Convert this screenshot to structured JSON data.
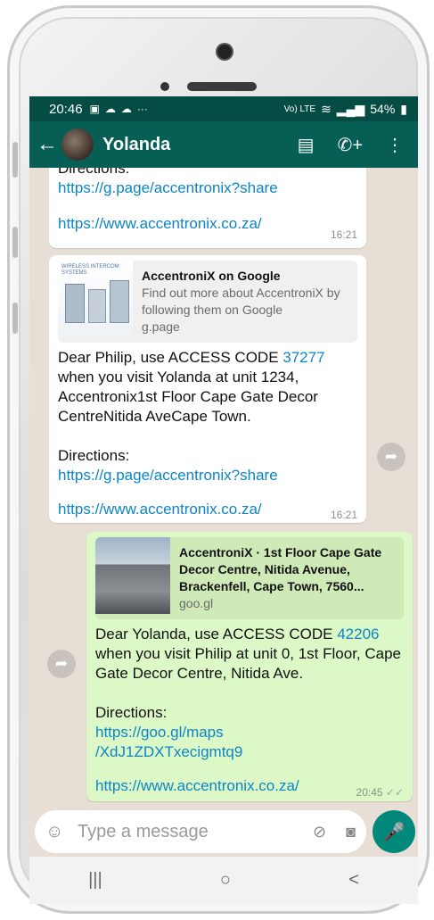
{
  "status_bar": {
    "time": "20:46",
    "left_icons": [
      "image-icon",
      "cloud-icon",
      "cloud-icon",
      "more-icon"
    ],
    "signal_label": "Vo) LTE",
    "battery": "54%"
  },
  "header": {
    "back_icon": "arrow-left-icon",
    "contact_name": "Yolanda",
    "actions": [
      "store-icon",
      "add-call-icon",
      "more-vert-icon"
    ]
  },
  "messages": [
    {
      "direction": "in",
      "partial_top": "Directions:",
      "links": [
        "https://g.page/accentronix?share",
        "https://www.accentronix.co.za/"
      ],
      "time": "16:21"
    },
    {
      "direction": "in",
      "preview": {
        "thumb_caption": "WIRELESS INTERCOM SYSTEMS",
        "title": "AccentroniX on Google",
        "desc": "Find out more about AccentroniX by following them on Google",
        "domain": "g.page"
      },
      "text_before": "Dear Philip, use ACCESS CODE ",
      "code": "37277",
      "text_after": "when you visit Yolanda at unit 1234, Accentronix1st Floor Cape Gate Decor CentreNitida AveCape Town.",
      "directions_label": "Directions:",
      "links": [
        "https://g.page/accentronix?share",
        "https://www.accentronix.co.za/"
      ],
      "time": "16:21"
    },
    {
      "direction": "out",
      "preview": {
        "title": "AccentroniX · 1st Floor Cape Gate Decor Centre, Nitida Avenue, Brackenfell, Cape Town, 7560...",
        "domain": "goo.gl"
      },
      "text_before": "Dear Yolanda, use ACCESS CODE ",
      "code": "42206",
      "text_after": "when you visit Philip at unit 0, 1st Floor, Cape Gate Decor Centre, Nitida Ave.",
      "directions_label": "Directions:",
      "links": [
        "https://goo.gl/maps /XdJ1ZDXTxecigmtq9",
        "https://www.accentronix.co.za/"
      ],
      "time": "20:45",
      "ticks": "✓✓"
    }
  ],
  "input": {
    "placeholder": "Type a message"
  },
  "nav": {
    "recents": "|||",
    "home": "○",
    "back": "<"
  },
  "colors": {
    "header": "#075e54",
    "status": "#054d44",
    "chat_bg": "#e7ded6",
    "outgoing": "#dcf8c6",
    "link": "#0c85c7",
    "accent": "#00897b"
  }
}
